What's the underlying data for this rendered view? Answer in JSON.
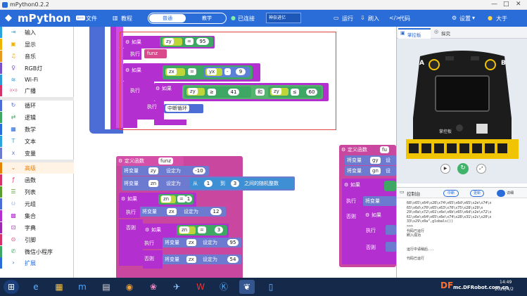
{
  "window": {
    "title": "mPython0.2.2"
  },
  "toolbar": {
    "logo": "mPython",
    "version": "beta",
    "file": "文件",
    "tutorial": "教程",
    "mode_normal": "普通",
    "mode_teaching": "教学",
    "connected": "已连接",
    "device": "神奈进亿",
    "run": "运行",
    "flash": "刷入",
    "code": "代码",
    "settings": "设置",
    "user": "大于",
    "colors": {
      "toolbar": "#2a6dd9"
    }
  },
  "sidebar": {
    "items": [
      {
        "label": "输入",
        "icon": "input-icon",
        "color": "#2aa3df"
      },
      {
        "label": "显示",
        "icon": "display-icon",
        "color": "#f0b400"
      },
      {
        "label": "音乐",
        "icon": "music-icon",
        "color": "#e79a1e"
      },
      {
        "label": "RGB灯",
        "icon": "bulb-icon",
        "color": "#7a52c7"
      },
      {
        "label": "Wi-Fi",
        "icon": "wifi-icon",
        "color": "#2e9bd8"
      },
      {
        "label": "广播",
        "icon": "broadcast-icon",
        "color": "#d7336b"
      },
      {
        "label": "循环",
        "icon": "loop-icon",
        "color": "#4c6cd6"
      },
      {
        "label": "逻辑",
        "icon": "logic-icon",
        "color": "#3fa764"
      },
      {
        "label": "数学",
        "icon": "math-icon",
        "color": "#2a6dd9"
      },
      {
        "label": "文本",
        "icon": "text-icon",
        "color": "#2aa3df"
      },
      {
        "label": "变量",
        "icon": "variable-icon",
        "color": "#6c7acf"
      },
      {
        "label": "高级",
        "icon": "chevron-down-icon",
        "color": "#e58200"
      },
      {
        "label": "函数",
        "icon": "function-icon",
        "color": "#d7336b"
      },
      {
        "label": "列表",
        "icon": "list-icon",
        "color": "#5a9f2d"
      },
      {
        "label": "元组",
        "icon": "tuple-icon",
        "color": "#4c6cd6"
      },
      {
        "label": "集合",
        "icon": "set-icon",
        "color": "#b32fd0"
      },
      {
        "label": "字典",
        "icon": "dict-icon",
        "color": "#9c27b0"
      },
      {
        "label": "引脚",
        "icon": "pin-icon",
        "color": "#d7336b"
      },
      {
        "label": "微信小程序",
        "icon": "wechat-icon",
        "color": "#3fa764"
      },
      {
        "label": "扩展",
        "icon": "chevron-right-icon",
        "color": "#2a6dd9"
      }
    ]
  },
  "blocks": {
    "if": "如果",
    "exec": "执行",
    "else": "否则",
    "and": "和",
    "var_zy": "zy",
    "var_zx": "zx",
    "var_zn": "zn",
    "var_yx": "yx",
    "var_gy": "gy",
    "var_gn": "gn",
    "op_eq": "=",
    "op_ge": "≥",
    "op_le": "≤",
    "op_minus": "-",
    "n95": "95",
    "n9": "9",
    "n41": "41",
    "n60": "60",
    "n1": "1",
    "n3": "3",
    "n12": "12",
    "n54": "54",
    "nm10": "-10",
    "call_funz": "funz",
    "break_loop": "中断循环",
    "def_func": "定义函数",
    "func_name": "funz",
    "func_name_right": "fu",
    "set_var": "将变量",
    "set_to": "设定为",
    "set_short": "设",
    "rand_from": "从",
    "rand_to": "到",
    "rand_tail": "之间的随机整数"
  },
  "panel": {
    "tab_board": "掌控板",
    "tab_explore": "探究",
    "board_text": "掌控板",
    "board_a": "A",
    "board_b": "B",
    "console_title": "控制台",
    "btn_clear": "中断",
    "btn_save": "更新",
    "btn_toggle": "详细",
    "console_lines": [
      "68\\x65\\x64\\x28\\x74\\x65\\x6d\\x65\\x2e\\x74\\x",
      "65\\x6d\\x70\\x65\\x63\\x70\\x75\\x28\\x29\\x",
      "29\\x0a\\x72\\x61\\x6e\\x6b\\x65\\x6d\\x2e\\x72\\x",
      "61\\x6e\\x64\\x65\\x6e\\x74\\x28\\x31\\x2c\\x20\\x",
      "33\\x29\\x0a\",globals())",
      ">>>",
      "代码已运行",
      "刷入成功",
      "",
      "",
      "运行中请稍后...",
      "",
      "代码已运行"
    ]
  },
  "taskbar": {
    "clock": "14:49",
    "date": "2020/4/2",
    "watermark": "mc.DFRobot.com.cn",
    "df": "DF"
  }
}
